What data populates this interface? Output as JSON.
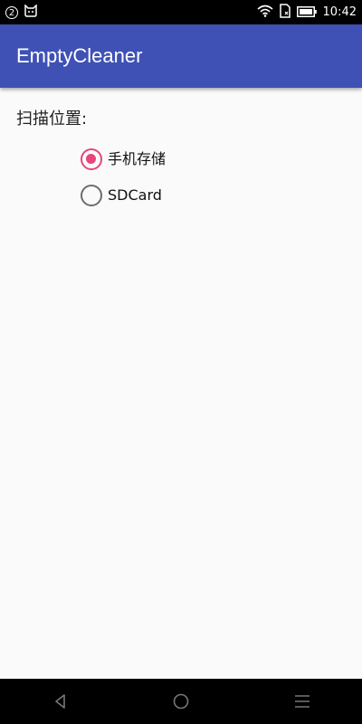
{
  "status_bar": {
    "notification_count": "2",
    "time": "10:42",
    "icons": [
      "notification-count-icon",
      "cat-app-icon",
      "wifi-icon",
      "sim-missing-icon",
      "battery-icon"
    ]
  },
  "app_bar": {
    "title": "EmptyCleaner",
    "color": "#3f51b5"
  },
  "scan": {
    "label": "扫描位置:",
    "options": [
      {
        "label": "手机存储",
        "checked": true
      },
      {
        "label": "SDCard",
        "checked": false
      }
    ],
    "accent_color": "#e8457c"
  },
  "nav_bar": {
    "icons": [
      "back-icon",
      "home-icon",
      "menu-icon"
    ]
  }
}
